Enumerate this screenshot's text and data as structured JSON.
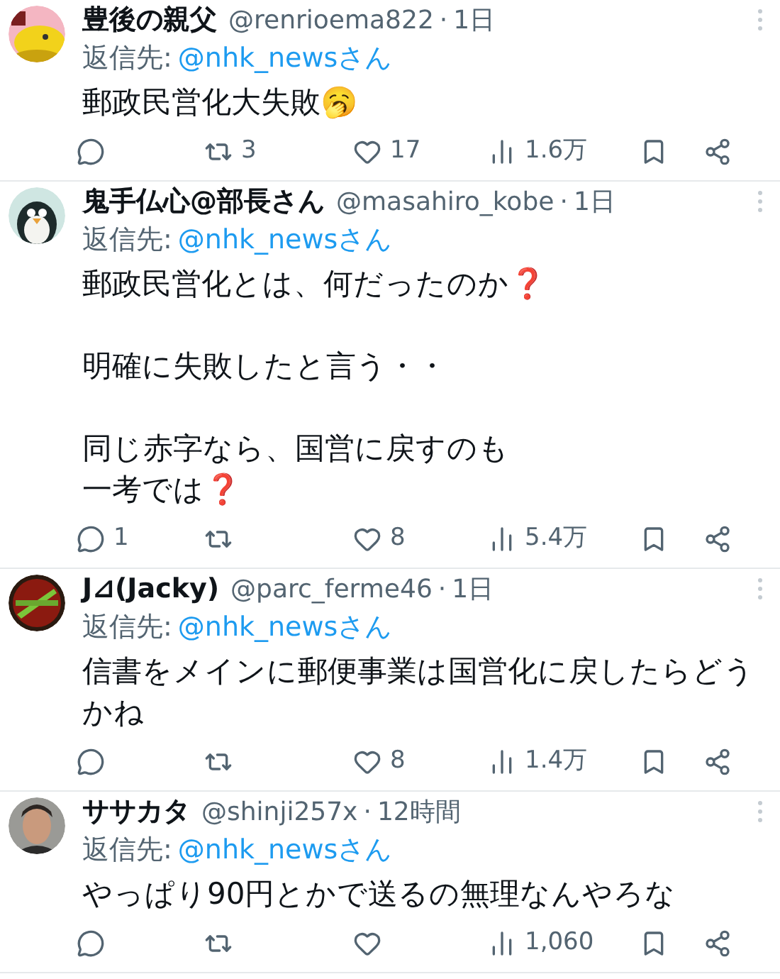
{
  "replies": [
    {
      "name": "豊後の親父",
      "handle": "@renrioema822",
      "separator": "·",
      "time": "1日",
      "reply_prefix": "返信先:",
      "reply_to": "@nhk_newsさん",
      "paragraphs": [
        {
          "lines": [
            "郵政民営化大失敗🥱"
          ]
        }
      ],
      "stats": {
        "retweets": "3",
        "likes": "17",
        "views": "1.6万"
      }
    },
    {
      "name": "鬼手仏心@部長さん",
      "handle": "@masahiro_kobe",
      "separator": "·",
      "time": "1日",
      "reply_prefix": "返信先:",
      "reply_to": "@nhk_newsさん",
      "paragraphs": [
        {
          "lines": [
            "郵政民営化とは、何だったのか❓"
          ]
        },
        {
          "lines": [
            "明確に失敗したと言う・・"
          ]
        },
        {
          "lines": [
            "同じ赤字なら、国営に戻すのも",
            "一考では❓"
          ]
        }
      ],
      "stats": {
        "replies": "1",
        "likes": "8",
        "views": "5.4万"
      }
    },
    {
      "name": "J⊿(Jacky)",
      "handle": "@parc_ferme46",
      "separator": "·",
      "time": "1日",
      "reply_prefix": "返信先:",
      "reply_to": "@nhk_newsさん",
      "paragraphs": [
        {
          "lines": [
            "信書をメインに郵便事業は国営化に戻したらどうかね"
          ]
        }
      ],
      "stats": {
        "likes": "8",
        "views": "1.4万"
      }
    },
    {
      "name": "ササカタ",
      "handle": "@shinji257x",
      "separator": "·",
      "time": "12時間",
      "reply_prefix": "返信先:",
      "reply_to": "@nhk_newsさん",
      "paragraphs": [
        {
          "lines": [
            "やっぱり90円とかで送るの無理なんやろな"
          ]
        }
      ],
      "stats": {
        "views": "1,060"
      }
    }
  ]
}
